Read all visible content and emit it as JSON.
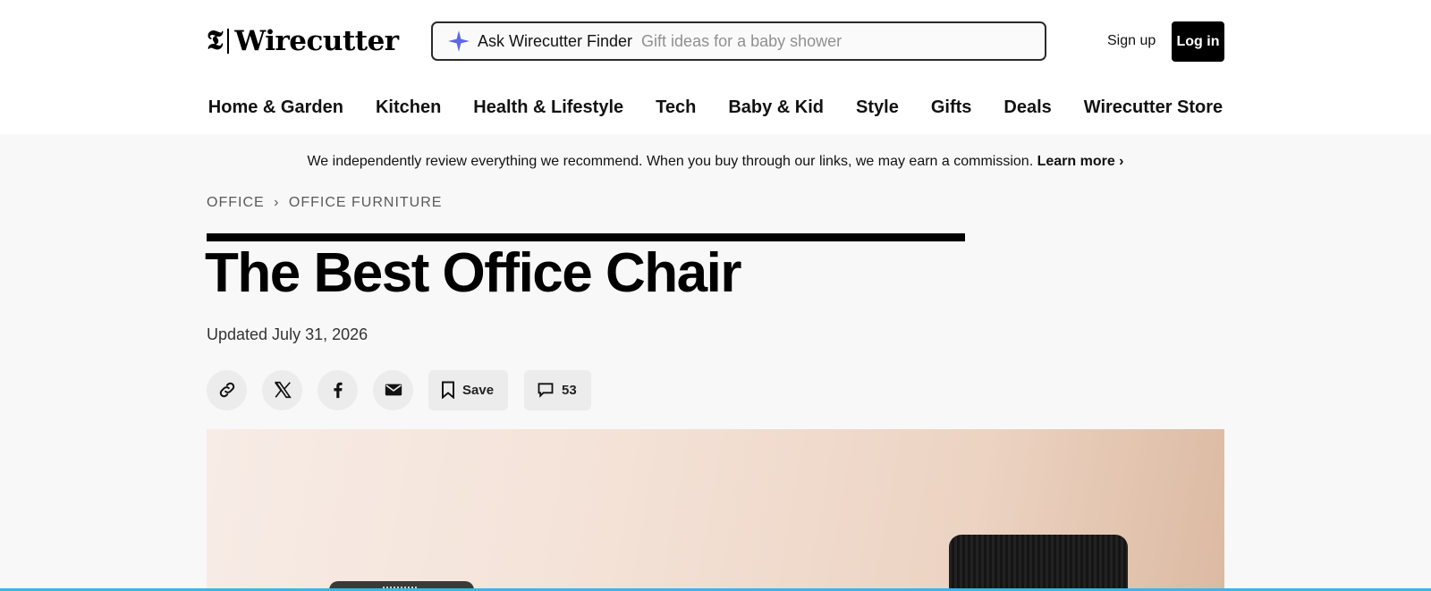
{
  "header": {
    "logo_mark": "𝕿",
    "logo_text": "Wirecutter",
    "search": {
      "label": "Ask Wirecutter Finder",
      "placeholder": "Gift ideas for a baby shower"
    },
    "sign_up": "Sign up",
    "log_in": "Log in"
  },
  "nav": {
    "items": [
      "Home & Garden",
      "Kitchen",
      "Health & Lifestyle",
      "Tech",
      "Baby & Kid",
      "Style",
      "Gifts",
      "Deals",
      "Wirecutter Store"
    ]
  },
  "disclosure": {
    "text": "We independently review everything we recommend. When you buy through our links, we may earn a commission.",
    "link": "Learn more ›"
  },
  "breadcrumb": {
    "items": [
      "OFFICE",
      "OFFICE FURNITURE"
    ],
    "separator": "›"
  },
  "article": {
    "title": "The Best Office Chair",
    "updated": "Updated July 31, 2026"
  },
  "share": {
    "icons": [
      "link-icon",
      "x-icon",
      "facebook-icon",
      "email-icon"
    ],
    "save_label": "Save",
    "comments_count": "53"
  },
  "colors": {
    "accent": "#5b66e8",
    "bottom_bar": "#3db5e6",
    "background": "#f8f8f8"
  }
}
